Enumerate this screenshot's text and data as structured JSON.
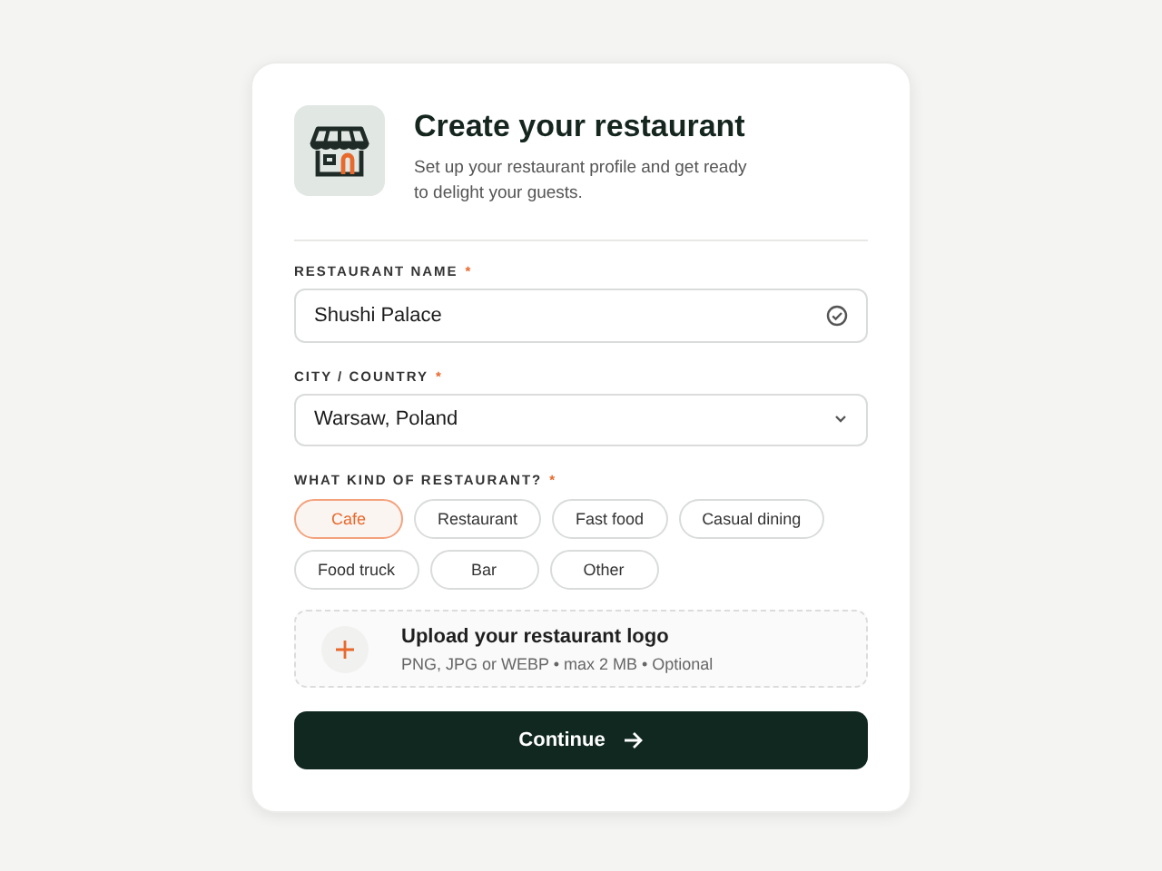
{
  "header": {
    "title": "Create your restaurant",
    "subtitle": "Set up your restaurant profile and get ready to delight your guests."
  },
  "fields": [
    {
      "kind": "text",
      "label": "RESTAURANT NAME",
      "required_mark": "*",
      "value": "Shushi Palace",
      "valid": true
    },
    {
      "kind": "select",
      "label": "CITY / COUNTRY",
      "required_mark": "*",
      "value": "Warsaw, Poland"
    }
  ],
  "restaurant_type": {
    "label": "WHAT KIND OF RESTAURANT?",
    "required_mark": "*",
    "options": [
      {
        "label": "Cafe",
        "selected": true
      },
      {
        "label": "Restaurant",
        "selected": false
      },
      {
        "label": "Fast food",
        "selected": false
      },
      {
        "label": "Casual dining",
        "selected": false
      },
      {
        "label": "Food truck",
        "selected": false
      },
      {
        "label": "Bar",
        "selected": false
      },
      {
        "label": "Other",
        "selected": false
      }
    ]
  },
  "upload": {
    "title": "Upload your restaurant logo",
    "hint": "PNG, JPG or WEBP • max 2 MB • Optional"
  },
  "button": {
    "label": "Continue"
  }
}
